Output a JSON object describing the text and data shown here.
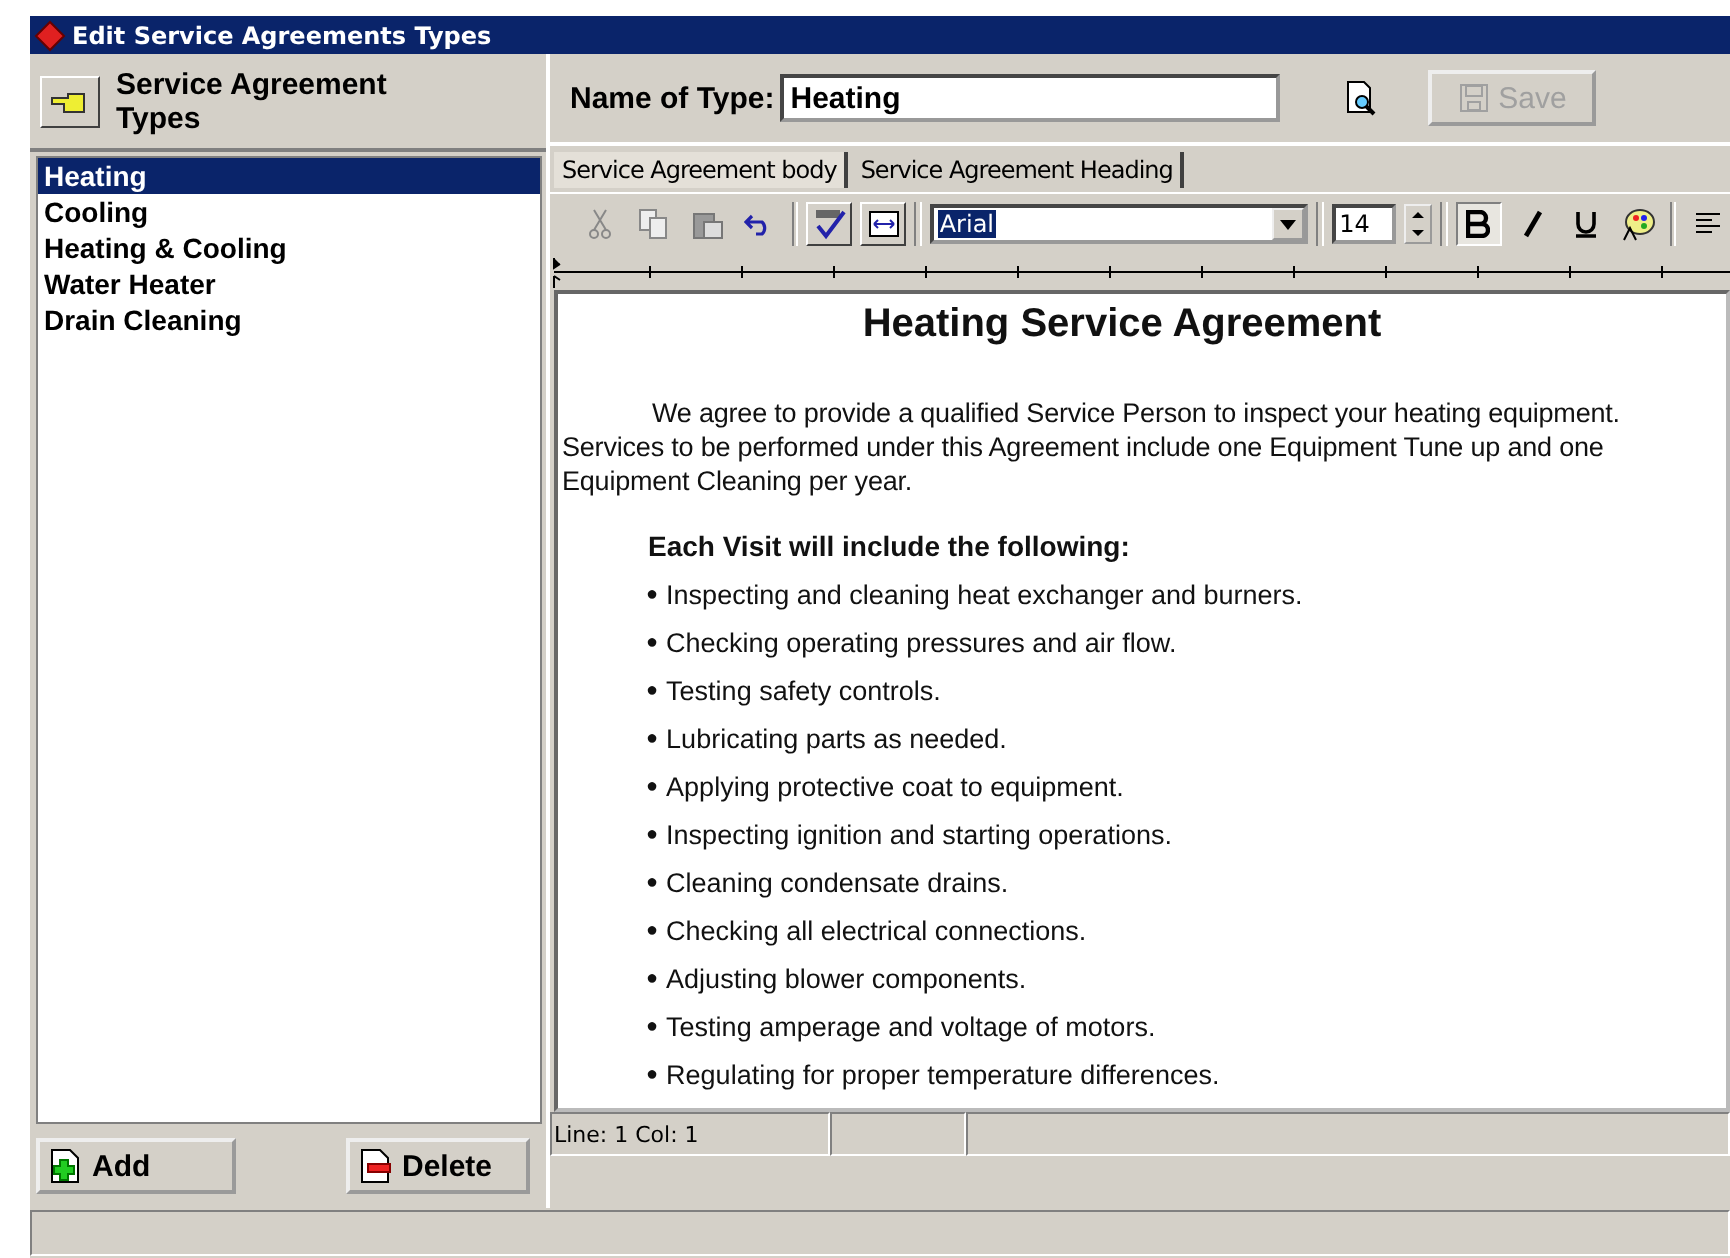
{
  "window": {
    "title": "Edit Service Agreements Types"
  },
  "sidebar": {
    "title": "Service Agreement Types",
    "items": [
      {
        "label": "Heating",
        "selected": true
      },
      {
        "label": "Cooling",
        "selected": false
      },
      {
        "label": "Heating & Cooling",
        "selected": false
      },
      {
        "label": "Water Heater",
        "selected": false
      },
      {
        "label": "Drain Cleaning",
        "selected": false
      }
    ],
    "buttons": [
      {
        "label": "Add",
        "kind": "add"
      },
      {
        "label": "Delete",
        "kind": "delete"
      }
    ]
  },
  "name_field": {
    "label": "Name of Type:",
    "value": "Heating"
  },
  "save_button": {
    "label": "Save",
    "disabled": true
  },
  "tabs": [
    {
      "label": "Service Agreement body",
      "selected": true
    },
    {
      "label": "Service Agreement Heading",
      "selected": false
    }
  ],
  "toolbar": {
    "font": "Arial",
    "size": "14",
    "bold": true
  },
  "document": {
    "heading": "Heating Service Agreement",
    "paragraph_lines": [
      "We agree to provide a qualified Service Person to inspect your heating equipment.",
      "Services to be performed under this Agreement include one Equipment Tune up and one",
      "Equipment Cleaning per year."
    ],
    "list_title": "Each Visit will include the following:",
    "bullet": "●",
    "items": [
      "Inspecting and cleaning heat exchanger and burners.",
      "Checking operating pressures and air flow.",
      "Testing safety controls.",
      "Lubricating parts as needed.",
      "Applying protective coat to equipment.",
      "Inspecting ignition and starting operations.",
      "Cleaning condensate drains.",
      "Checking all electrical connections.",
      "Adjusting blower components.",
      "Testing amperage and voltage of motors.",
      "Regulating for proper temperature differences."
    ]
  },
  "editor_status": {
    "position": "Line:  1  Col:  1"
  }
}
